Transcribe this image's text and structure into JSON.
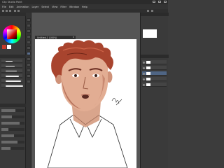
{
  "window": {
    "title": "Clip Studio Paint"
  },
  "menu": [
    "File",
    "Edit",
    "Animation",
    "Layer",
    "Select",
    "View",
    "Filter",
    "Window",
    "Help"
  ],
  "document": {
    "tab_label": "Untitled-1 (100%)",
    "close_glyph": "x"
  },
  "colors": {
    "accent": "#5b6f8e",
    "main_color": "#c63a2a",
    "sub_color": "#ffffff",
    "panel_bg": "#3a3a3a",
    "canvas_bg": "#555555"
  },
  "tools": [
    "zoom-tool",
    "move-tool",
    "select-tool",
    "eyedropper-tool",
    "pen-tool",
    "pencil-tool",
    "brush-tool",
    "airbrush-tool",
    "eraser-tool",
    "fill-tool",
    "gradient-tool",
    "text-tool"
  ],
  "brushes": [
    {
      "icon": "brush-stroke-icon"
    },
    {
      "icon": "brush-stroke-icon"
    },
    {
      "icon": "brush-stroke-icon"
    },
    {
      "icon": "brush-stroke-icon"
    },
    {
      "icon": "brush-stroke-icon"
    },
    {
      "icon": "brush-stroke-icon"
    }
  ],
  "tool_properties": [
    {
      "value": 0.6
    },
    {
      "value": 0.45
    },
    {
      "value": 0.8
    },
    {
      "value": 0.3
    },
    {
      "value": 0.55
    },
    {
      "value": 0.7
    },
    {
      "value": 0.4
    }
  ],
  "layers": [
    {
      "selected": false
    },
    {
      "selected": false
    },
    {
      "selected": true
    },
    {
      "selected": false
    },
    {
      "selected": false
    }
  ]
}
